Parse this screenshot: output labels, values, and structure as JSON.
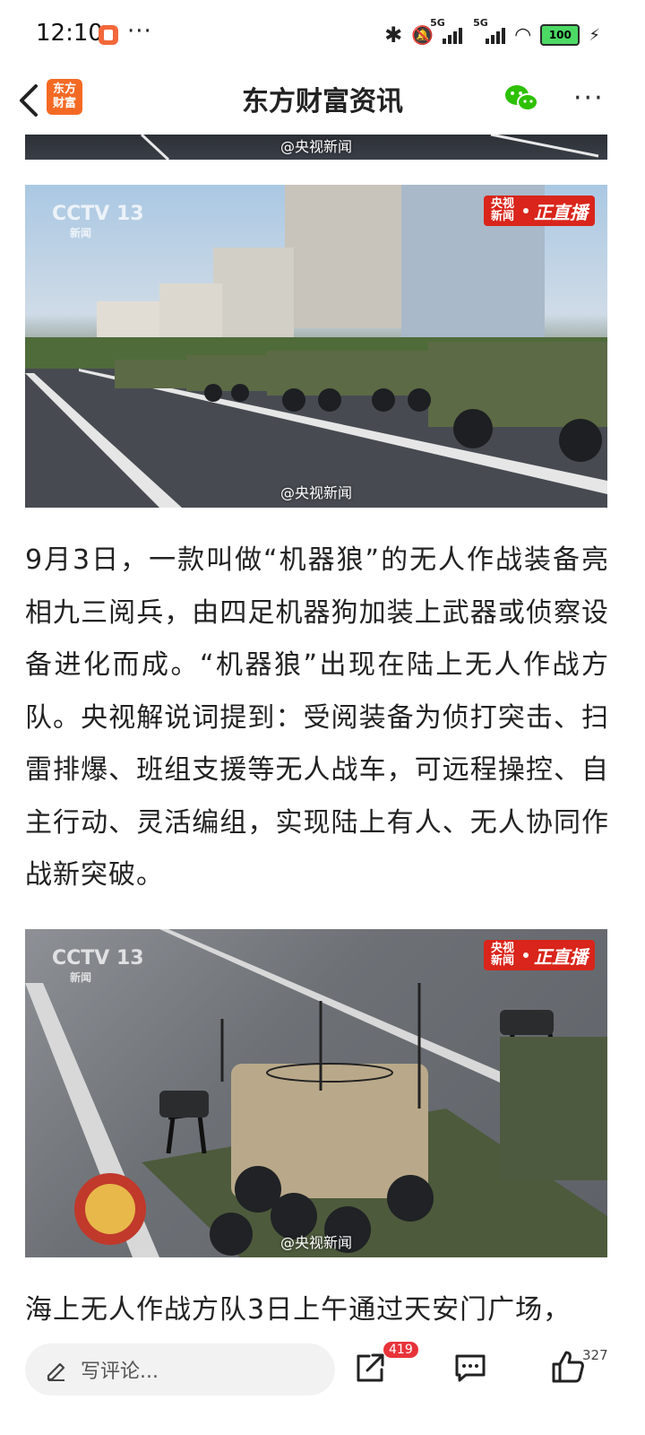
{
  "status_bar": {
    "time": "12:10",
    "more": "···",
    "network_1": "5G",
    "network_2": "5G",
    "battery": "100"
  },
  "header": {
    "logo_text": "东方\n财富",
    "title": "东方财富资讯",
    "more": "···"
  },
  "images": [
    {
      "watermark": "@央视新闻"
    },
    {
      "watermark": "@央视新闻",
      "channel": "CCTV 13",
      "channel_sub": "新闻",
      "live_left": "央视\n新闻",
      "live_right": "正直播"
    },
    {
      "watermark": "@央视新闻",
      "channel": "CCTV 13",
      "channel_sub": "新闻",
      "live_left": "央视\n新闻",
      "live_right": "正直播"
    }
  ],
  "article": {
    "paragraph_1": "9月3日，一款叫做“机器狼”的无人作战装备亮相九三阅兵，由四足机器狗加装上武器或侦察设备进化而成。“机器狼”出现在陆上无人作战方队。央视解说词提到：受阅装备为侦打突击、扫雷排爆、班组支援等无人战车，可远程操控、自主行动、灵活编组，实现陆上有人、无人协同作战新突破。",
    "paragraph_2": "海上无人作战方队3日上午通过天安门广场，"
  },
  "bottom_bar": {
    "comment_placeholder": "写评论...",
    "share_badge": "419",
    "like_count": "327"
  },
  "colors": {
    "brand_orange": "#f46a24",
    "badge_red": "#e8333a",
    "live_red": "#d9251b",
    "wechat_green": "#2dc100"
  }
}
